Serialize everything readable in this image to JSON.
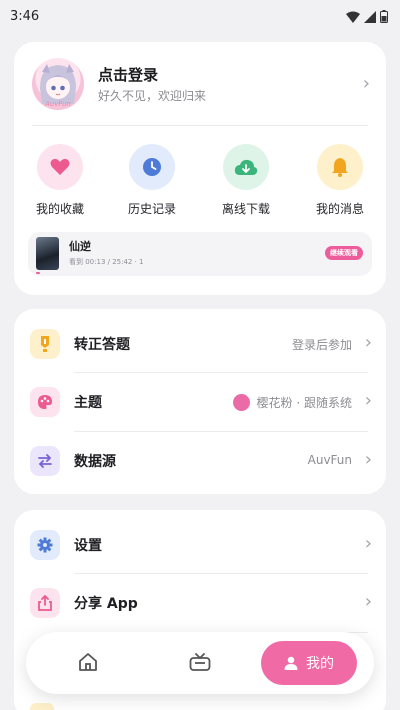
{
  "status_bar": {
    "time": "3:46"
  },
  "profile": {
    "title": "点击登录",
    "subtitle": "好久不见，欢迎归来",
    "avatar_caption": "AuvFun"
  },
  "quick_actions": [
    {
      "label": "我的收藏",
      "icon": "heart-icon",
      "color": "#ec5a8f",
      "bg": "#fde3ee"
    },
    {
      "label": "历史记录",
      "icon": "clock-icon",
      "color": "#4e7bd8",
      "bg": "#e1ebfb"
    },
    {
      "label": "离线下载",
      "icon": "cloud-download-icon",
      "color": "#3bb57c",
      "bg": "#def4e8"
    },
    {
      "label": "我的消息",
      "icon": "bell-icon",
      "color": "#f2a51f",
      "bg": "#fdf0cb"
    }
  ],
  "history": {
    "title": "仙逆",
    "meta": "看到 00:13 / 25:42 · 1",
    "resume_label": "继续观看",
    "progress": 0.01
  },
  "menu_group_1": [
    {
      "label": "转正答题",
      "value": "登录后参加",
      "icon": "medal-icon"
    },
    {
      "label": "主题",
      "value": "樱花粉 · 跟随系统",
      "icon": "palette-icon"
    },
    {
      "label": "数据源",
      "value": "AuvFun",
      "icon": "swap-icon"
    }
  ],
  "menu_group_2": [
    {
      "label": "设置",
      "icon": "gear-icon"
    },
    {
      "label": "分享 App",
      "icon": "share-icon"
    }
  ],
  "bottom_nav": {
    "active_label": "我的"
  },
  "colors": {
    "accent": "#f06aa6",
    "background": "#f1f1f4"
  }
}
